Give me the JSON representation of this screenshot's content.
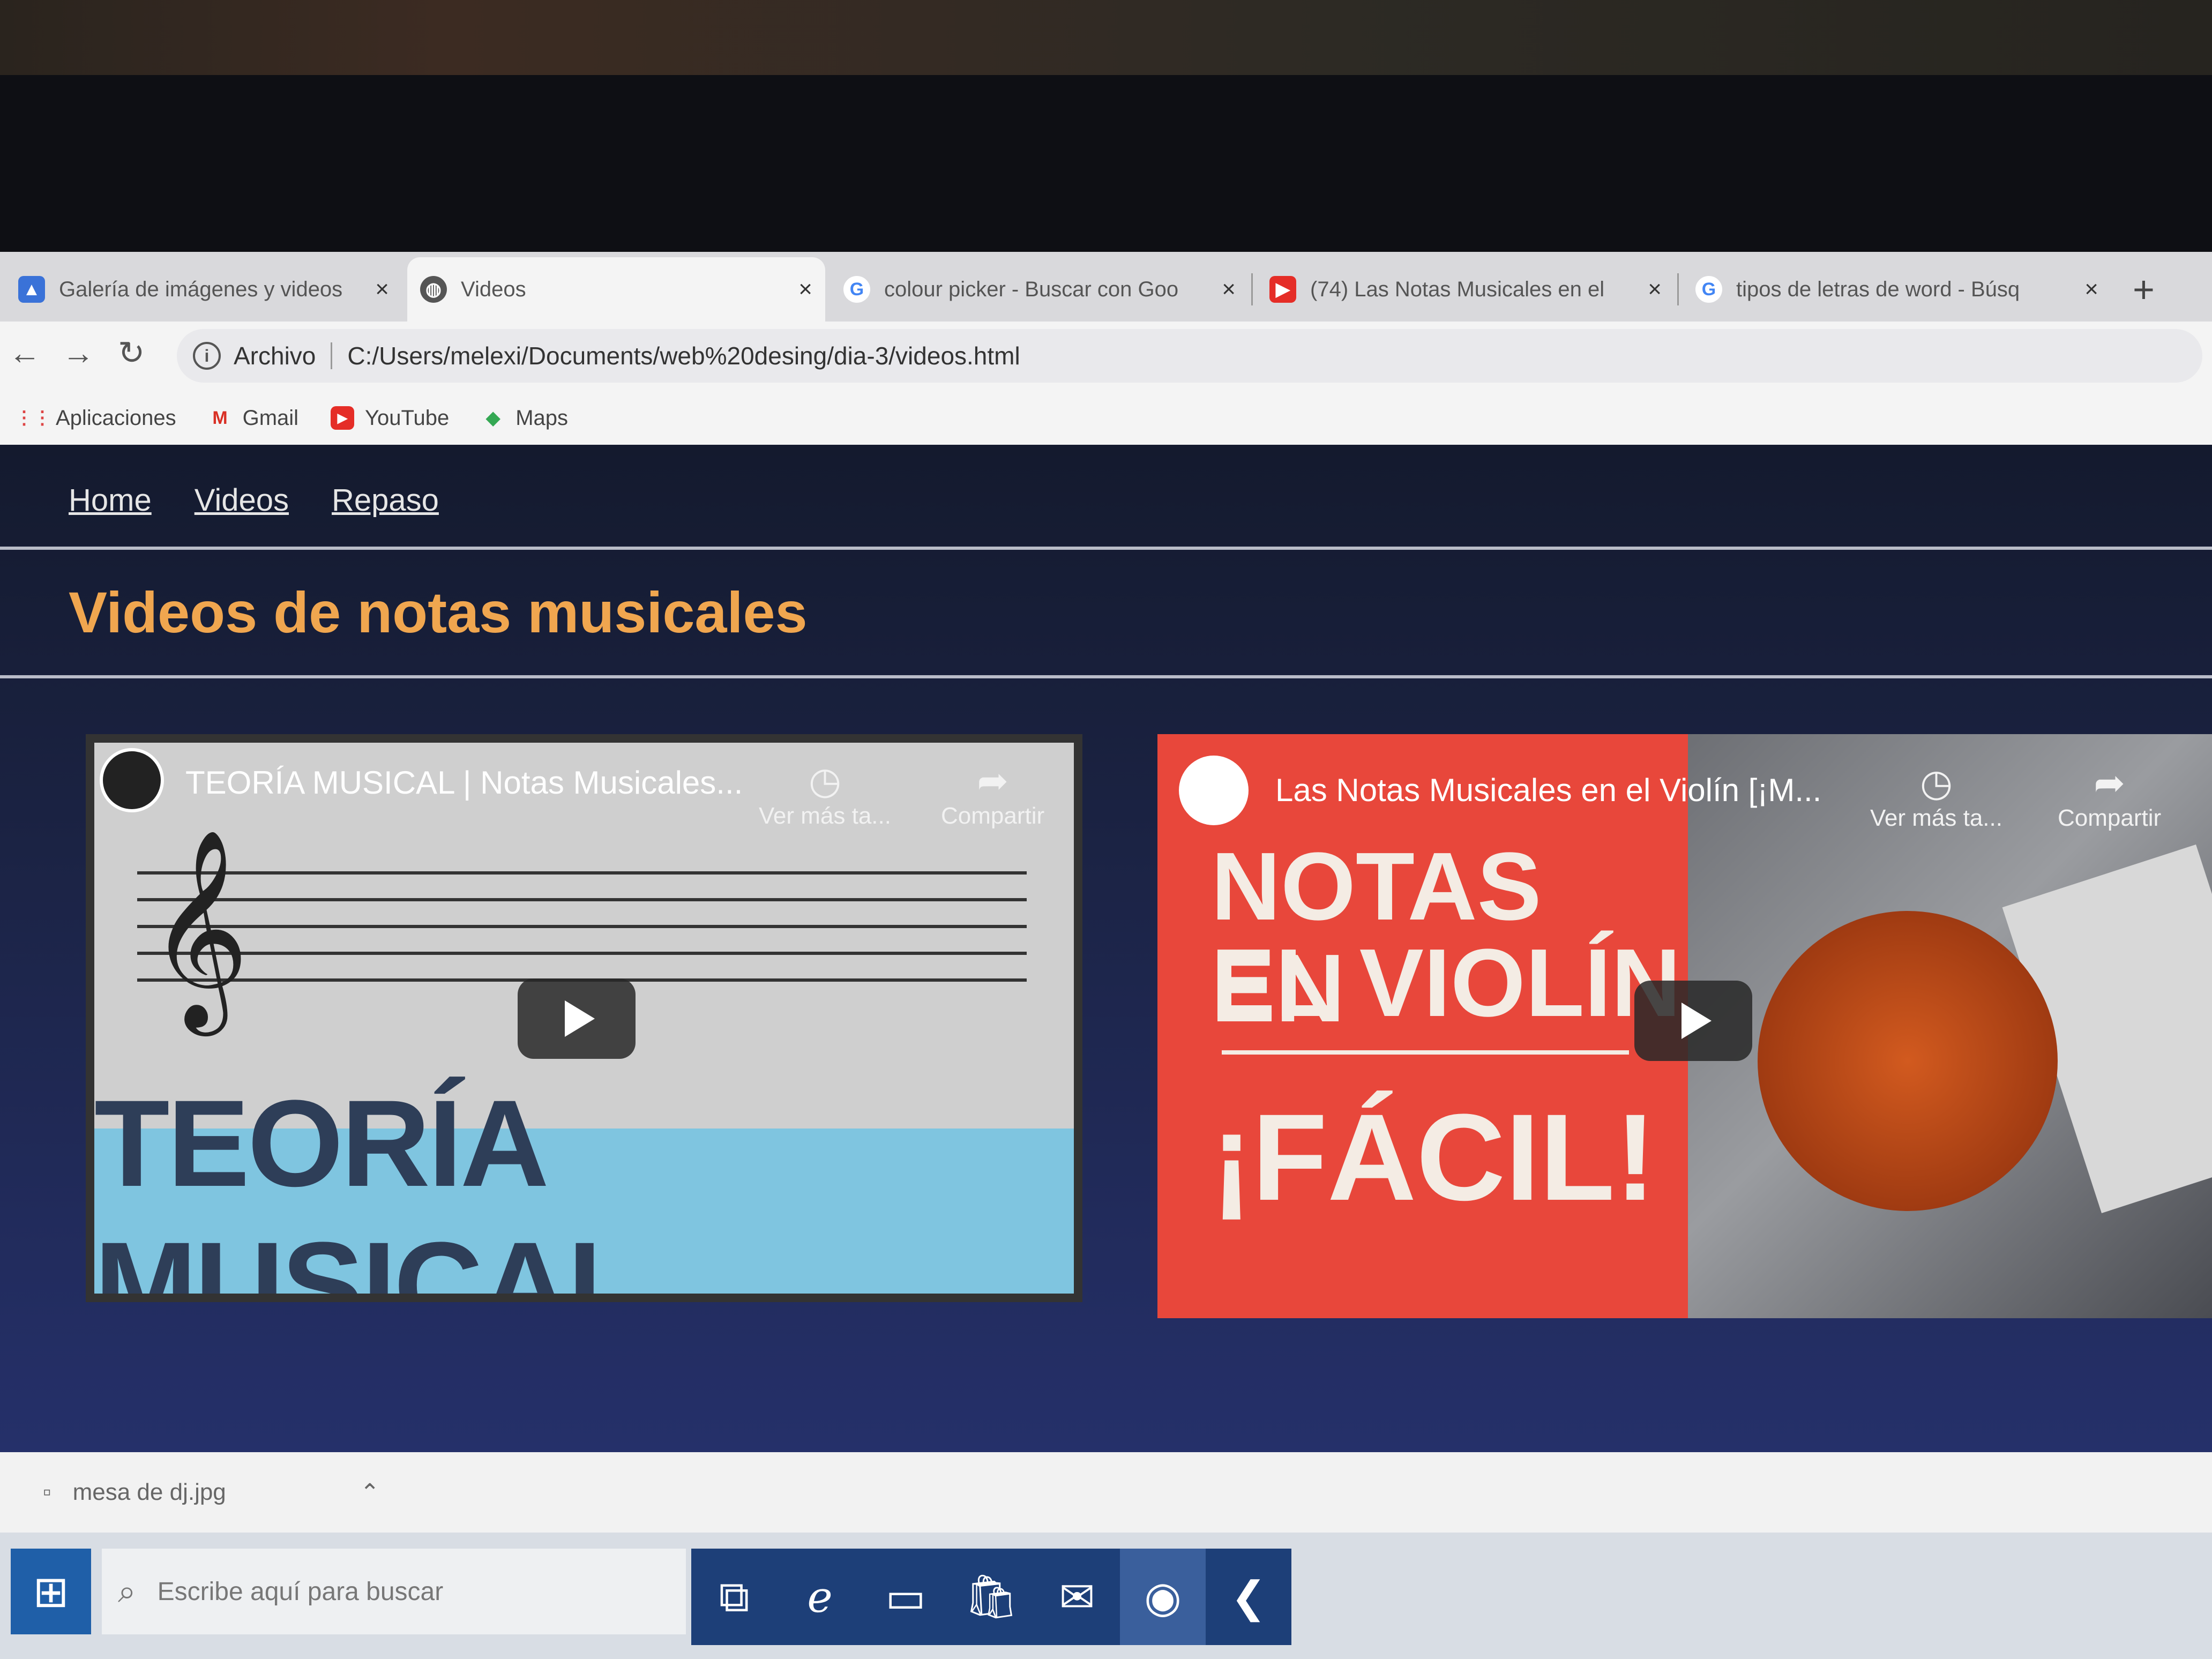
{
  "browser": {
    "tabs": [
      {
        "title": "Galería de imágenes y videos",
        "icon": "person-icon",
        "active": false
      },
      {
        "title": "Videos",
        "icon": "globe-icon",
        "active": true
      },
      {
        "title": "colour picker - Buscar con Goo",
        "icon": "google-icon",
        "active": false
      },
      {
        "title": "(74) Las Notas Musicales en el",
        "icon": "youtube-icon",
        "active": false
      },
      {
        "title": "tipos de letras de word - Búsq",
        "icon": "google-icon",
        "active": false
      }
    ],
    "close_glyph": "×",
    "new_tab_glyph": "+",
    "address": {
      "label": "Archivo",
      "url": "C:/Users/melexi/Documents/web%20desing/dia-3/videos.html"
    },
    "bookmarks": [
      {
        "label": "Aplicaciones",
        "icon": "apps-grid-icon"
      },
      {
        "label": "Gmail",
        "icon": "gmail-icon"
      },
      {
        "label": "YouTube",
        "icon": "youtube-icon"
      },
      {
        "label": "Maps",
        "icon": "maps-icon"
      }
    ]
  },
  "page": {
    "nav": [
      "Home",
      "Videos",
      "Repaso"
    ],
    "heading": "Videos de notas musicales",
    "heading_color": "#f0a64f",
    "videos": [
      {
        "title": "TEORÍA MUSICAL | Notas Musicales...",
        "watch_later": "Ver más ta...",
        "share": "Compartir",
        "thumbnail_text": "TEORÍA MUSICAL"
      },
      {
        "title": "Las Notas Musicales en el Violín [¡M...",
        "watch_later": "Ver más ta...",
        "share": "Compartir",
        "thumbnail_line1": "NOTAS EN",
        "thumbnail_line2": "EL VIOLÍN",
        "thumbnail_line3": "¡FÁCIL!"
      }
    ]
  },
  "download_bar": {
    "file": "mesa de dj.jpg"
  },
  "taskbar": {
    "search_placeholder": "Escribe aquí para buscar"
  }
}
